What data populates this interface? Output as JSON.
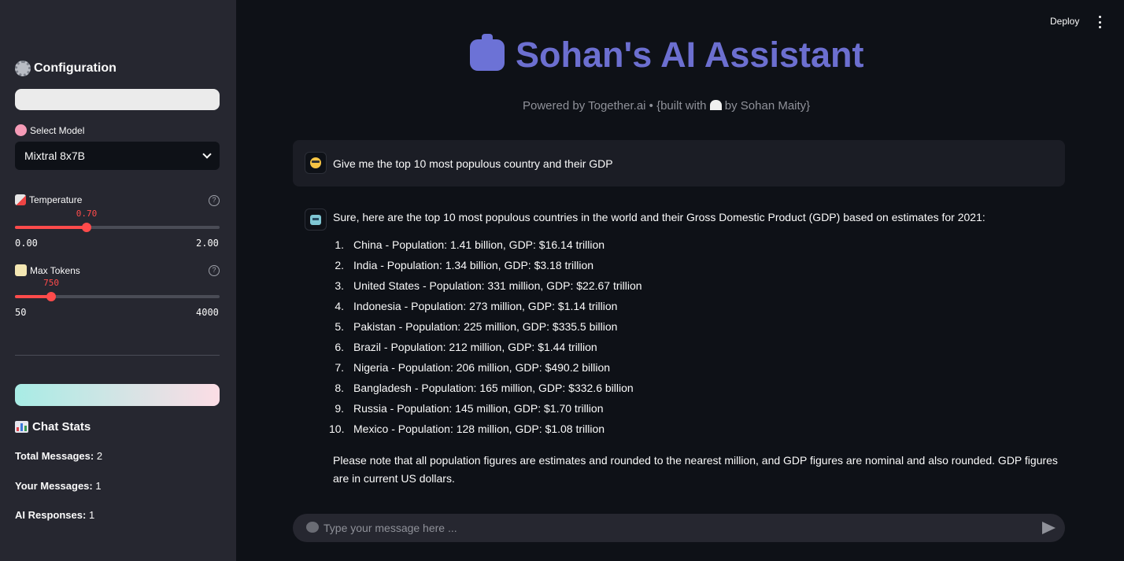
{
  "sidebar": {
    "header": "Configuration",
    "model_label": "Select Model",
    "model_value": "Mixtral 8x7B",
    "temperature": {
      "label": "Temperature",
      "value": "0.70",
      "min": "0.00",
      "max": "2.00",
      "fraction": 0.35
    },
    "max_tokens": {
      "label": "Max Tokens",
      "value": "750",
      "min": "50",
      "max": "4000",
      "fraction": 0.177
    },
    "stats_title": "Chat Stats",
    "stats": [
      {
        "label": "Total Messages:",
        "value": "2"
      },
      {
        "label": "Your Messages:",
        "value": "1"
      },
      {
        "label": "AI Responses:",
        "value": "1"
      }
    ]
  },
  "topbar": {
    "deploy_label": "Deploy"
  },
  "header": {
    "title": "Sohan's AI Assistant",
    "subtitle_pre": "Powered by Together.ai • {built with",
    "subtitle_post": "by Sohan Maity}"
  },
  "chat": {
    "user_message": "Give me the top 10 most populous country and their GDP",
    "ai_intro": "Sure, here are the top 10 most populous countries in the world and their Gross Domestic Product (GDP) based on estimates for 2021:",
    "items": [
      {
        "num": "1.",
        "text": "China - Population: 1.41 billion, GDP: $16.14 trillion"
      },
      {
        "num": "2.",
        "text": "India - Population: 1.34 billion, GDP: $3.18 trillion"
      },
      {
        "num": "3.",
        "text": "United States - Population: 331 million, GDP: $22.67 trillion"
      },
      {
        "num": "4.",
        "text": "Indonesia - Population: 273 million, GDP: $1.14 trillion"
      },
      {
        "num": "5.",
        "text": "Pakistan - Population: 225 million, GDP: $335.5 billion"
      },
      {
        "num": "6.",
        "text": "Brazil - Population: 212 million, GDP: $1.44 trillion"
      },
      {
        "num": "7.",
        "text": "Nigeria - Population: 206 million, GDP: $490.2 billion"
      },
      {
        "num": "8.",
        "text": "Bangladesh - Population: 165 million, GDP: $332.6 billion"
      },
      {
        "num": "9.",
        "text": "Russia - Population: 145 million, GDP: $1.70 trillion"
      },
      {
        "num": "10.",
        "text": "Mexico - Population: 128 million, GDP: $1.08 trillion"
      }
    ],
    "ai_note": "Please note that all population figures are estimates and rounded to the nearest million, and GDP figures are nominal and also rounded. GDP figures are in current US dollars."
  },
  "input": {
    "placeholder": "Type your message here ..."
  },
  "colors": {
    "accent": "#ff4b4b",
    "title": "#6c6fd0",
    "sidebar_bg": "#262730",
    "main_bg": "#0e1117"
  }
}
